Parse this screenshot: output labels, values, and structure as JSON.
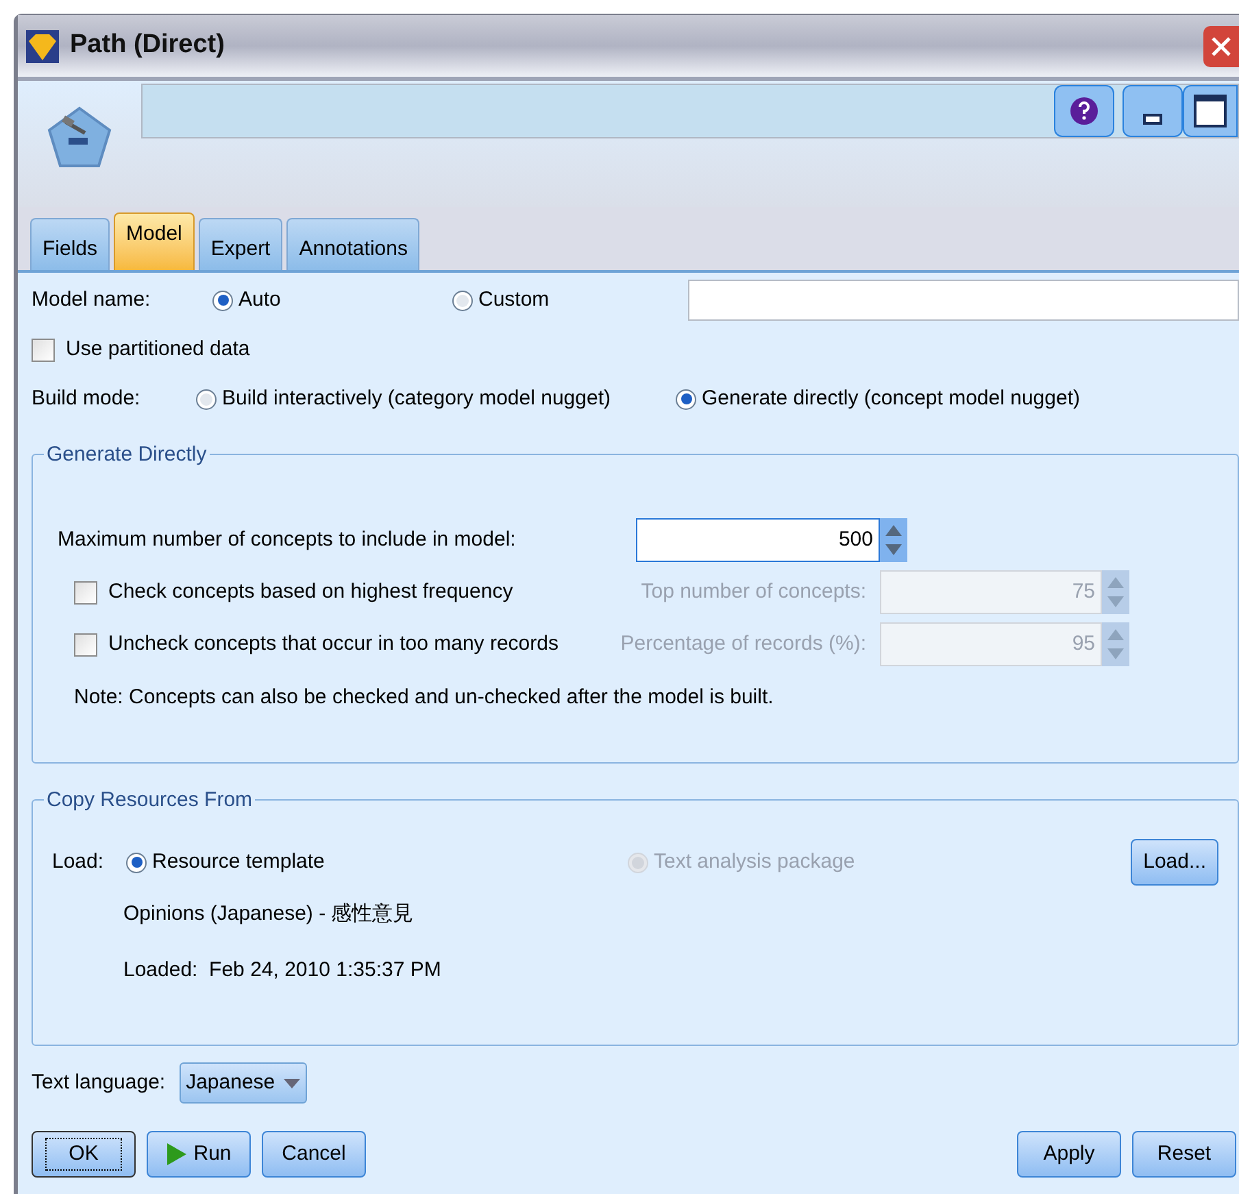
{
  "window": {
    "title": "Path (Direct)"
  },
  "tabs": [
    {
      "label": "Fields",
      "selected": false
    },
    {
      "label": "Model",
      "selected": true
    },
    {
      "label": "Expert",
      "selected": false
    },
    {
      "label": "Annotations",
      "selected": false
    }
  ],
  "model_name": {
    "label": "Model name:",
    "options": [
      {
        "label": "Auto",
        "selected": true
      },
      {
        "label": "Custom",
        "selected": false
      }
    ]
  },
  "use_partitioned": {
    "label": "Use partitioned data",
    "checked": false
  },
  "build_mode": {
    "label": "Build mode:",
    "options": [
      {
        "label": "Build interactively (category model nugget)",
        "selected": false
      },
      {
        "label": "Generate directly (concept model nugget)",
        "selected": true
      }
    ]
  },
  "generate_directly": {
    "title": "Generate Directly",
    "max_label": "Maximum number of concepts to include in model:",
    "max_value": "500",
    "options": [
      {
        "label": "Check concepts based on highest frequency",
        "checked": false,
        "field_label": "Top number of concepts:",
        "value": "75",
        "disabled": true
      },
      {
        "label": "Uncheck concepts that occur in too many records",
        "checked": false,
        "field_label": "Percentage of records (%):",
        "value": "95",
        "disabled": true
      }
    ],
    "note": "Note: Concepts can also be checked and un-checked after the model is built."
  },
  "copy_resources": {
    "title": "Copy Resources From",
    "load_label": "Load:",
    "options": [
      {
        "label": "Resource template",
        "selected": true,
        "disabled": false
      },
      {
        "label": "Text analysis package",
        "selected": false,
        "disabled": true
      }
    ],
    "load_button": "Load...",
    "template": "Opinions (Japanese) - 感性意見",
    "loaded": "Loaded:  Feb 24, 2010 1:35:37 PM"
  },
  "text_language": {
    "label": "Text language:",
    "value": "Japanese"
  },
  "buttons_left": [
    {
      "label": "OK",
      "kind": "default"
    },
    {
      "label": "Run",
      "kind": "run"
    },
    {
      "label": "Cancel",
      "kind": "plain"
    }
  ],
  "buttons_right": [
    {
      "label": "Apply",
      "kind": "plain"
    },
    {
      "label": "Reset",
      "kind": "plain"
    }
  ]
}
